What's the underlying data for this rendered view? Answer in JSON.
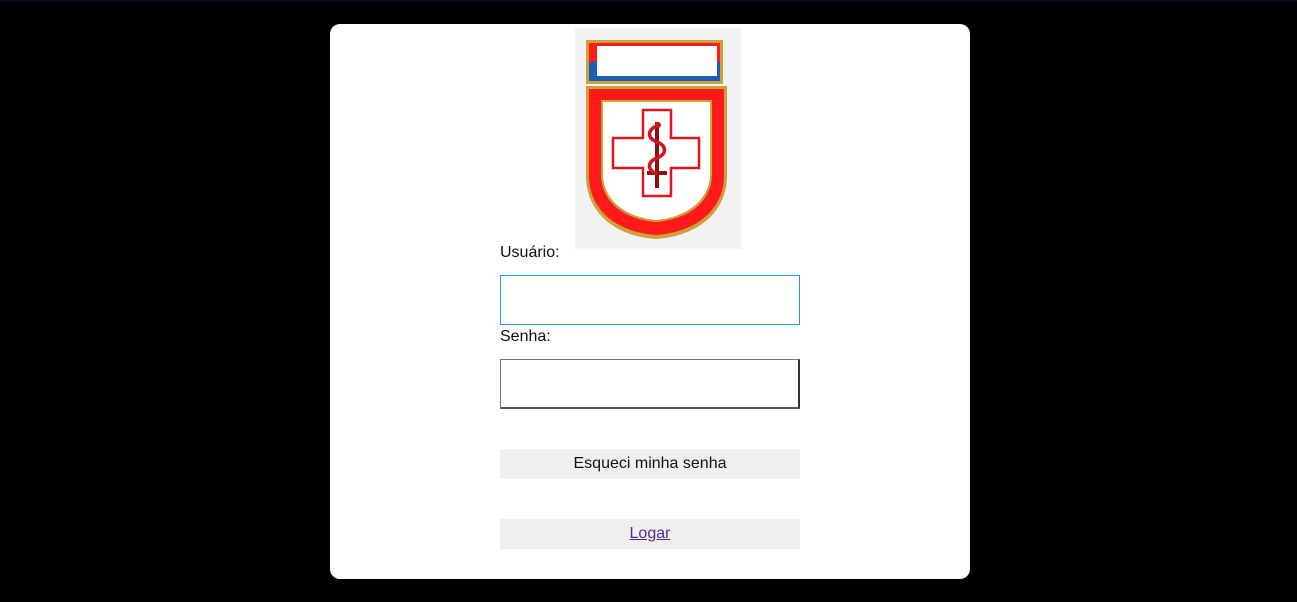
{
  "form": {
    "username_label": "Usuário:",
    "username_value": "",
    "password_label": "Senha:",
    "password_value": "",
    "forgot_password_label": "Esqueci minha senha",
    "login_label": "Logar"
  },
  "emblem": {
    "icon": "medical-shield-emblem-icon"
  },
  "colors": {
    "page_background": "#000000",
    "card_background": "#ffffff",
    "focused_field_border": "#1e9ad6",
    "button_background": "#efefef",
    "login_link": "#5a2a8c",
    "emblem_red": "#ff1a1a",
    "emblem_gold": "#c9a23a",
    "emblem_blue": "#1a5fb4"
  }
}
